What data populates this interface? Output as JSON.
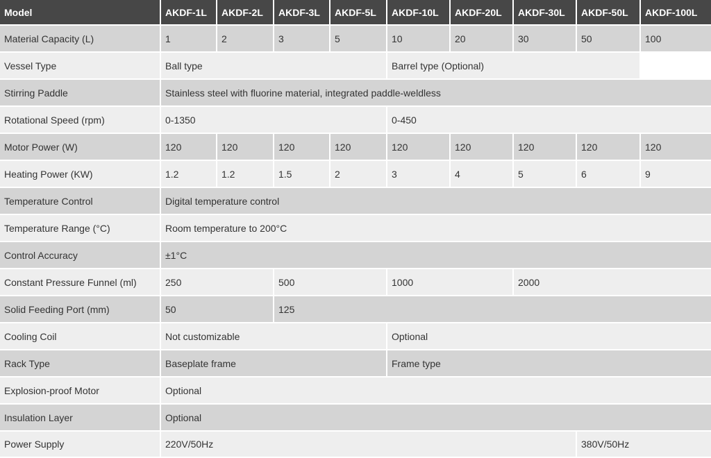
{
  "header": [
    "Model",
    "AKDF-1L",
    "AKDF-2L",
    "AKDF-3L",
    "AKDF-5L",
    "AKDF-10L",
    "AKDF-20L",
    "AKDF-30L",
    "AKDF-50L",
    "AKDF-100L"
  ],
  "rows": [
    {
      "label": "Material Capacity (L)",
      "cells": [
        {
          "text": "1"
        },
        {
          "text": "2"
        },
        {
          "text": "3"
        },
        {
          "text": "5"
        },
        {
          "text": "10"
        },
        {
          "text": "20"
        },
        {
          "text": "30"
        },
        {
          "text": "50"
        },
        {
          "text": "100"
        }
      ]
    },
    {
      "label": "Vessel Type",
      "cells": [
        {
          "text": "Ball type",
          "span": 4
        },
        {
          "text": "Barrel type (Optional)",
          "span": 4
        },
        {
          "text": "",
          "blank": true
        }
      ]
    },
    {
      "label": "Stirring Paddle",
      "cells": [
        {
          "text": "Stainless steel with fluorine material, integrated paddle-weldless",
          "span": 9
        }
      ]
    },
    {
      "label": "Rotational Speed (rpm)",
      "cells": [
        {
          "text": "0-1350",
          "span": 4
        },
        {
          "text": "0-450",
          "span": 5
        }
      ]
    },
    {
      "label": "Motor Power (W)",
      "cells": [
        {
          "text": "120"
        },
        {
          "text": "120"
        },
        {
          "text": "120"
        },
        {
          "text": "120"
        },
        {
          "text": "120"
        },
        {
          "text": "120"
        },
        {
          "text": "120"
        },
        {
          "text": "120"
        },
        {
          "text": "120"
        }
      ]
    },
    {
      "label": "Heating Power (KW)",
      "cells": [
        {
          "text": "1.2"
        },
        {
          "text": "1.2"
        },
        {
          "text": "1.5"
        },
        {
          "text": "2"
        },
        {
          "text": "3"
        },
        {
          "text": "4"
        },
        {
          "text": "5"
        },
        {
          "text": "6"
        },
        {
          "text": "9"
        }
      ]
    },
    {
      "label": "Temperature Control",
      "cells": [
        {
          "text": "Digital temperature control",
          "span": 9
        }
      ]
    },
    {
      "label": "Temperature Range (°C)",
      "cells": [
        {
          "text": "Room temperature to 200°C",
          "span": 9
        }
      ]
    },
    {
      "label": "Control Accuracy",
      "cells": [
        {
          "text": "±1°C",
          "span": 9
        }
      ]
    },
    {
      "label": "Constant Pressure Funnel (ml)",
      "cells": [
        {
          "text": "250",
          "span": 2
        },
        {
          "text": "500",
          "span": 2
        },
        {
          "text": "1000",
          "span": 2
        },
        {
          "text": "2000",
          "span": 3
        }
      ]
    },
    {
      "label": "Solid Feeding Port (mm)",
      "cells": [
        {
          "text": "50",
          "span": 2
        },
        {
          "text": "125",
          "span": 7
        }
      ]
    },
    {
      "label": "Cooling Coil",
      "cells": [
        {
          "text": "Not customizable",
          "span": 4
        },
        {
          "text": "Optional",
          "span": 5
        }
      ]
    },
    {
      "label": "Rack Type",
      "cells": [
        {
          "text": "Baseplate frame",
          "span": 4
        },
        {
          "text": "Frame type",
          "span": 5
        }
      ]
    },
    {
      "label": "Explosion-proof Motor",
      "cells": [
        {
          "text": "Optional",
          "span": 9
        }
      ]
    },
    {
      "label": "Insulation Layer",
      "cells": [
        {
          "text": "Optional",
          "span": 9
        }
      ]
    },
    {
      "label": "Power Supply",
      "cells": [
        {
          "text": "220V/50Hz",
          "span": 7
        },
        {
          "text": "380V/50Hz",
          "span": 2
        }
      ]
    }
  ]
}
